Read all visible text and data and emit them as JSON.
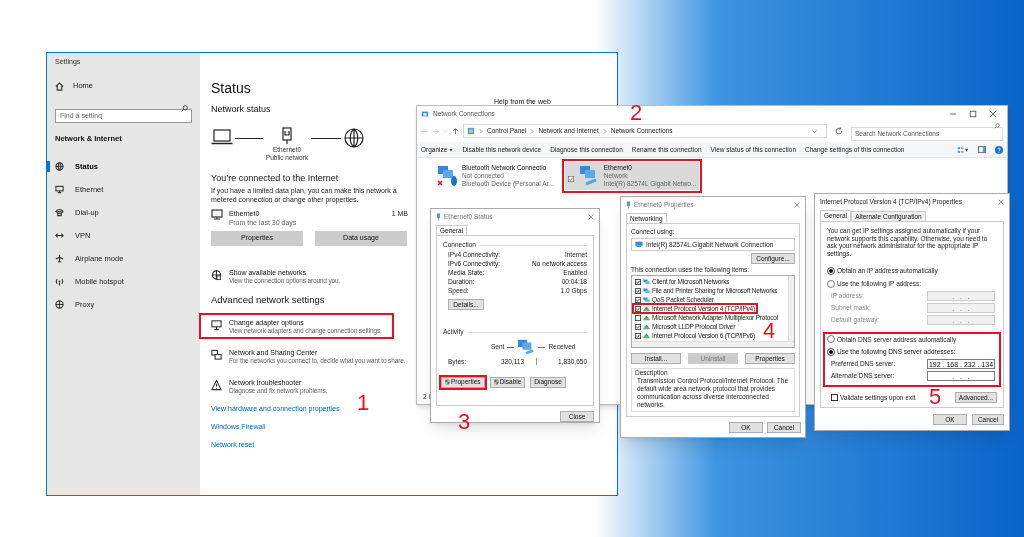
{
  "settings": {
    "title": "Settings",
    "home": "Home",
    "search_placeholder": "Find a setting",
    "section": "Network & Internet",
    "nav": [
      {
        "label": "Status",
        "kind": "status",
        "selected": true
      },
      {
        "label": "Ethernet",
        "kind": "ethernet",
        "selected": false
      },
      {
        "label": "Dial-up",
        "kind": "dialup",
        "selected": false
      },
      {
        "label": "VPN",
        "kind": "vpn",
        "selected": false
      },
      {
        "label": "Airplane mode",
        "kind": "airplane",
        "selected": false
      },
      {
        "label": "Mobile hotspot",
        "kind": "hotspot",
        "selected": false
      },
      {
        "label": "Proxy",
        "kind": "proxy",
        "selected": false
      }
    ],
    "page_title": "Status",
    "network_status": "Network status",
    "adapter_name": "Ethernet0",
    "network_type": "Public network",
    "connected_heading": "You’re connected to the Internet",
    "connected_text": "If you have a limited data plan, you can make this network a metered connection or change other properties.",
    "usage": {
      "name": "Ethernet0",
      "period": "From the last 30 days",
      "amount": "1 MB"
    },
    "buttons": [
      "Properties",
      "Data usage"
    ],
    "show_networks": {
      "kind": "networks",
      "title": "Show available networks",
      "description": "View the connection options around you."
    },
    "advanced_heading": "Advanced network settings",
    "advanced_options": [
      {
        "kind": "adapter",
        "title": "Change adapter options",
        "description": "View network adapters and change connection settings."
      },
      {
        "kind": "sharing",
        "title": "Network and Sharing Center",
        "description": "For the networks you connect to, decide what you want to share."
      },
      {
        "kind": "troubleshooter",
        "title": "Network troubleshooter",
        "description": "Diagnose and fix network problems."
      }
    ],
    "links": [
      "View hardware and connection properties",
      "Windows Firewall",
      "Network reset"
    ],
    "help_heading": "Help from the web"
  },
  "network_connections": {
    "title": "Network Connections",
    "breadcrumb": [
      "Control Panel",
      "Network and Internet",
      "Network Connections"
    ],
    "search_placeholder": "Search Network Connections",
    "toolbar": [
      "Organize",
      "Disable this network device",
      "Diagnose this connection",
      "Rename this connection",
      "View status of this connection",
      "Change settings of this connection"
    ],
    "connections": [
      {
        "kind": "bluetooth",
        "name": "Bluetooth Network Connectio",
        "status": "Not connected",
        "device": "Bluetooth Device (Personal Ar...",
        "selected": false
      },
      {
        "kind": "ethernet",
        "name": "Ethernet0",
        "status": "Network",
        "device": "Intel(R) 82574L Gigabit Netwo...",
        "selected": true
      }
    ],
    "status_bar": "2 i"
  },
  "ethernet_status": {
    "title": "Ethernet0 Status",
    "tab": "General",
    "connection_heading": "Connection",
    "rows": [
      {
        "label": "IPv4 Connectivity:",
        "value": "Internet"
      },
      {
        "label": "IPv6 Connectivity:",
        "value": "No network access"
      },
      {
        "label": "Media State:",
        "value": "Enabled"
      },
      {
        "label": "Duration:",
        "value": "00:04:18"
      },
      {
        "label": "Speed:",
        "value": "1.0 Gbps"
      }
    ],
    "details_button": "Details...",
    "activity_heading": "Activity",
    "sent_label": "Sent",
    "received_label": "Received",
    "bytes_label": "Bytes:",
    "sent": "320,113",
    "received": "1,830,650",
    "buttons": [
      {
        "label": "Properties",
        "shield": true
      },
      {
        "label": "Disable",
        "shield": true
      },
      {
        "label": "Diagnose",
        "shield": false
      }
    ],
    "close": "Close"
  },
  "ethernet_properties": {
    "title": "Ethernet0 Properties",
    "tab": "Networking",
    "connect_using_label": "Connect using:",
    "adapter": "Intel(R) 82574L Gigabit Network Connection",
    "configure": "Configure...",
    "items_label": "This connection uses the following items:",
    "items": [
      {
        "kind": "client",
        "label": "Client for Microsoft Networks",
        "checked": true
      },
      {
        "kind": "client",
        "label": "File and Printer Sharing for Microsoft Networks",
        "checked": true
      },
      {
        "kind": "client",
        "label": "QoS Packet Scheduler",
        "checked": true
      },
      {
        "kind": "protocol",
        "label": "Internet Protocol Version 4 (TCP/IPv4)",
        "checked": true
      },
      {
        "kind": "protocol",
        "label": "Microsoft Network Adapter Multiplexor Protocol",
        "checked": false
      },
      {
        "kind": "protocol",
        "label": "Microsoft LLDP Protocol Driver",
        "checked": true
      },
      {
        "kind": "protocol",
        "label": "Internet Protocol Version 6 (TCP/IPv6)",
        "checked": true
      }
    ],
    "buttons": [
      {
        "label": "Install...",
        "disabled": false
      },
      {
        "label": "Uninstall",
        "disabled": true
      },
      {
        "label": "Properties",
        "disabled": false
      }
    ],
    "description_heading": "Description",
    "description": "Transmission Control Protocol/Internet Protocol. The default wide area network protocol that provides communication across diverse interconnected networks.",
    "ok": "OK",
    "cancel": "Cancel"
  },
  "ipv4": {
    "title": "Internet Protocol Version 4 (TCP/IPv4) Properties",
    "tabs": [
      {
        "label": "General",
        "selected": true
      },
      {
        "label": "Alternate Configuration",
        "selected": false
      }
    ],
    "intro": "You can get IP settings assigned automatically if your network supports this capability. Otherwise, you need to ask your network administrator for the appropriate IP settings.",
    "ip_options": [
      {
        "label": "Obtain an IP address automatically",
        "selected": true
      },
      {
        "label": "Use the following IP address:",
        "selected": false
      }
    ],
    "ip_fields_disabled": true,
    "ip_fields": [
      {
        "label": "IP address:",
        "value": ".   .   ."
      },
      {
        "label": "Subnet mask:",
        "value": ".   .   ."
      },
      {
        "label": "Default gateway:",
        "value": ".   .   ."
      }
    ],
    "dns_options": [
      {
        "label": "Obtain DNS server address automatically",
        "selected": false
      },
      {
        "label": "Use the following DNS server addresses:",
        "selected": true
      }
    ],
    "dns_fields": [
      {
        "label": "Preferred DNS server:",
        "value": "192 . 168 . 232 . 134"
      },
      {
        "label": "Alternate DNS server:",
        "value": ".   .   ."
      }
    ],
    "validate": {
      "label": "Validate settings upon exit",
      "checked": false
    },
    "advanced": "Advanced...",
    "ok": "OK",
    "cancel": "Cancel"
  },
  "annotations": [
    {
      "number": "1"
    },
    {
      "number": "2"
    },
    {
      "number": "3"
    },
    {
      "number": "4"
    },
    {
      "number": "5"
    }
  ]
}
